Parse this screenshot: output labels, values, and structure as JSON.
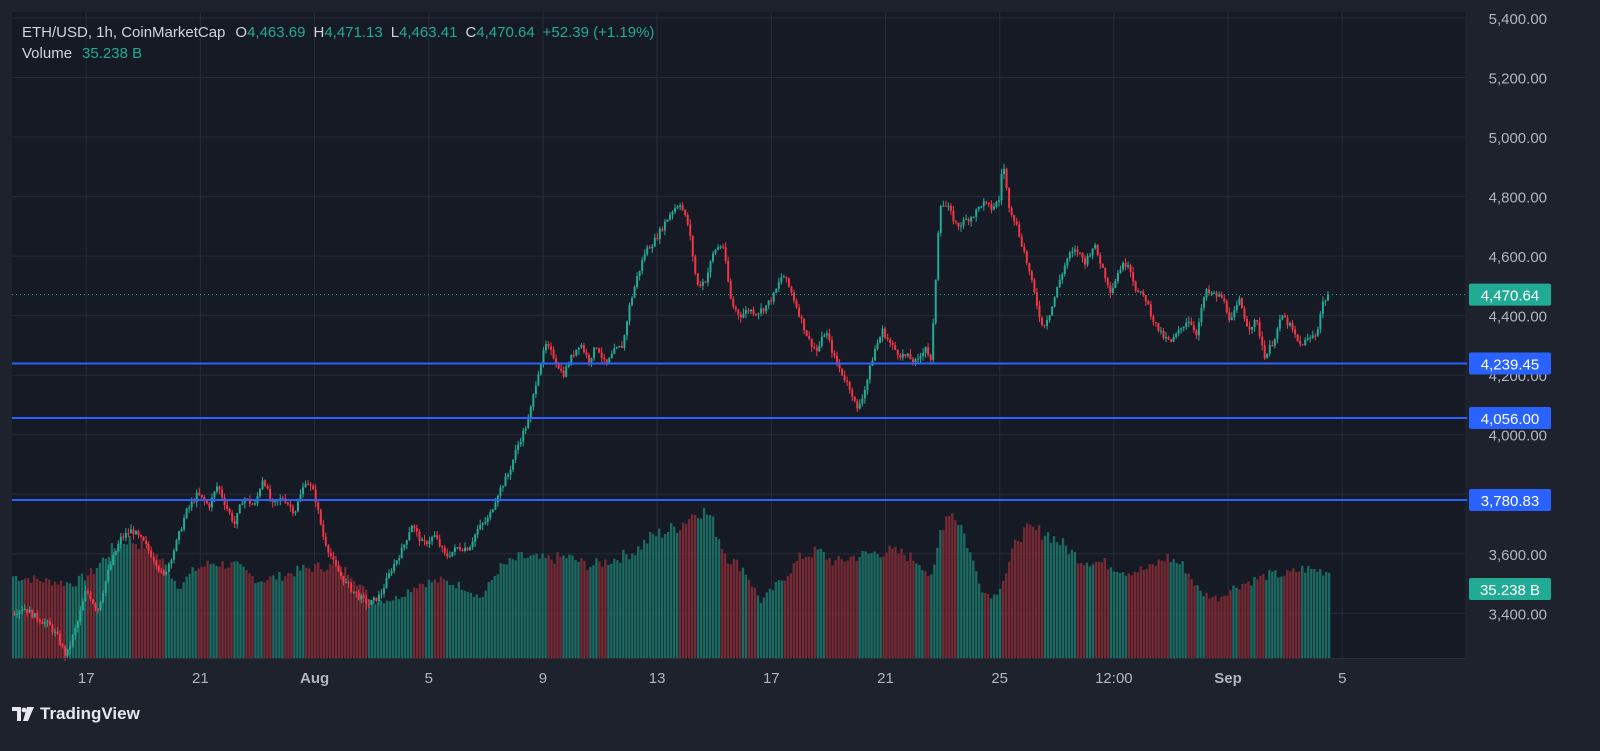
{
  "header": {
    "symbol": "ETH/USD, 1h, CoinMarketCap",
    "open_label": "O",
    "open": "4,463.69",
    "high_label": "H",
    "high": "4,471.13",
    "low_label": "L",
    "low": "4,463.41",
    "close_label": "C",
    "close": "4,470.64",
    "change": "+52.39 (+1.19%)",
    "volume_label": "Volume",
    "volume": "35.238 B"
  },
  "branding": {
    "logo_text": "TradingView"
  },
  "colors": {
    "background": "#1e222d",
    "plot_background": "#161a25",
    "grid": "#262b38",
    "up": "#22ab94",
    "down": "#f23645",
    "level_line": "#2962ff",
    "level_badge": "#2962ff",
    "price_badge": "#22ab94",
    "volume_up": "#1b6e63",
    "volume_down": "#7a2a33"
  },
  "chart_data": {
    "type": "candlestick",
    "symbol": "ETH/USD",
    "interval": "1h",
    "source": "CoinMarketCap",
    "ylim": [
      3250,
      5420
    ],
    "y_ticks": [
      3400,
      3600,
      3800,
      4000,
      4200,
      4400,
      4600,
      4800,
      5000,
      5200,
      5400
    ],
    "y_tick_labels": [
      "3,400.00",
      "3,600.00",
      "3,800.00",
      "4,000.00",
      "4,200.00",
      "4,400.00",
      "4,600.00",
      "4,800.00",
      "5,000.00",
      "5,200.00",
      "5,400.00"
    ],
    "x_ticks": [
      {
        "x": 1,
        "label": "17"
      },
      {
        "x": 5,
        "label": "21"
      },
      {
        "x": 9,
        "label": "Aug"
      },
      {
        "x": 13,
        "label": "5"
      },
      {
        "x": 17,
        "label": "9"
      },
      {
        "x": 21,
        "label": "13"
      },
      {
        "x": 25,
        "label": "17"
      },
      {
        "x": 29,
        "label": "21"
      },
      {
        "x": 33,
        "label": "25"
      },
      {
        "x": 37,
        "label": "12:00"
      },
      {
        "x": 41,
        "label": "Sep"
      },
      {
        "x": 45,
        "label": "5"
      }
    ],
    "x_range": [
      -1.6,
      49.3
    ],
    "price_path": [
      [
        -1.6,
        3400
      ],
      [
        -1.2,
        3420
      ],
      [
        -0.8,
        3390
      ],
      [
        -0.3,
        3360
      ],
      [
        0.0,
        3320
      ],
      [
        0.3,
        3255
      ],
      [
        0.7,
        3370
      ],
      [
        1.0,
        3480
      ],
      [
        1.4,
        3410
      ],
      [
        1.8,
        3550
      ],
      [
        2.2,
        3650
      ],
      [
        2.6,
        3680
      ],
      [
        3.0,
        3640
      ],
      [
        3.4,
        3580
      ],
      [
        3.7,
        3520
      ],
      [
        4.1,
        3620
      ],
      [
        4.5,
        3740
      ],
      [
        4.9,
        3800
      ],
      [
        5.3,
        3760
      ],
      [
        5.6,
        3830
      ],
      [
        5.9,
        3760
      ],
      [
        6.2,
        3700
      ],
      [
        6.5,
        3790
      ],
      [
        6.9,
        3760
      ],
      [
        7.2,
        3860
      ],
      [
        7.5,
        3760
      ],
      [
        7.9,
        3790
      ],
      [
        8.3,
        3740
      ],
      [
        8.7,
        3850
      ],
      [
        9.0,
        3800
      ],
      [
        9.3,
        3660
      ],
      [
        9.7,
        3560
      ],
      [
        10.1,
        3500
      ],
      [
        10.5,
        3460
      ],
      [
        10.9,
        3430
      ],
      [
        11.3,
        3460
      ],
      [
        11.7,
        3550
      ],
      [
        12.1,
        3620
      ],
      [
        12.4,
        3700
      ],
      [
        12.8,
        3630
      ],
      [
        13.2,
        3660
      ],
      [
        13.6,
        3590
      ],
      [
        14.0,
        3620
      ],
      [
        14.4,
        3620
      ],
      [
        14.7,
        3680
      ],
      [
        15.1,
        3720
      ],
      [
        15.4,
        3800
      ],
      [
        15.8,
        3870
      ],
      [
        16.1,
        3960
      ],
      [
        16.5,
        4050
      ],
      [
        16.8,
        4200
      ],
      [
        17.1,
        4300
      ],
      [
        17.4,
        4260
      ],
      [
        17.7,
        4200
      ],
      [
        18.0,
        4260
      ],
      [
        18.3,
        4310
      ],
      [
        18.6,
        4250
      ],
      [
        18.9,
        4300
      ],
      [
        19.2,
        4230
      ],
      [
        19.5,
        4280
      ],
      [
        19.8,
        4300
      ],
      [
        20.0,
        4420
      ],
      [
        20.3,
        4530
      ],
      [
        20.6,
        4620
      ],
      [
        20.9,
        4650
      ],
      [
        21.2,
        4700
      ],
      [
        21.5,
        4750
      ],
      [
        21.8,
        4780
      ],
      [
        22.1,
        4700
      ],
      [
        22.4,
        4500
      ],
      [
        22.7,
        4520
      ],
      [
        23.0,
        4620
      ],
      [
        23.3,
        4640
      ],
      [
        23.6,
        4440
      ],
      [
        23.9,
        4400
      ],
      [
        24.2,
        4420
      ],
      [
        24.5,
        4410
      ],
      [
        24.8,
        4430
      ],
      [
        25.1,
        4470
      ],
      [
        25.4,
        4540
      ],
      [
        25.7,
        4480
      ],
      [
        26.0,
        4400
      ],
      [
        26.3,
        4320
      ],
      [
        26.6,
        4280
      ],
      [
        26.9,
        4350
      ],
      [
        27.2,
        4260
      ],
      [
        27.5,
        4200
      ],
      [
        27.8,
        4150
      ],
      [
        28.0,
        4080
      ],
      [
        28.3,
        4160
      ],
      [
        28.6,
        4280
      ],
      [
        28.9,
        4350
      ],
      [
        29.2,
        4300
      ],
      [
        29.5,
        4270
      ],
      [
        29.8,
        4260
      ],
      [
        30.1,
        4240
      ],
      [
        30.4,
        4300
      ],
      [
        30.6,
        4240
      ],
      [
        30.8,
        4600
      ],
      [
        30.9,
        4780
      ],
      [
        31.2,
        4760
      ],
      [
        31.5,
        4700
      ],
      [
        31.8,
        4720
      ],
      [
        32.1,
        4740
      ],
      [
        32.4,
        4780
      ],
      [
        32.7,
        4760
      ],
      [
        33.0,
        4790
      ],
      [
        33.1,
        4930
      ],
      [
        33.3,
        4780
      ],
      [
        33.6,
        4700
      ],
      [
        33.9,
        4600
      ],
      [
        34.2,
        4480
      ],
      [
        34.5,
        4360
      ],
      [
        34.8,
        4420
      ],
      [
        35.1,
        4520
      ],
      [
        35.4,
        4600
      ],
      [
        35.7,
        4620
      ],
      [
        36.0,
        4580
      ],
      [
        36.3,
        4640
      ],
      [
        36.6,
        4560
      ],
      [
        36.9,
        4480
      ],
      [
        37.2,
        4560
      ],
      [
        37.5,
        4580
      ],
      [
        37.8,
        4480
      ],
      [
        38.1,
        4460
      ],
      [
        38.4,
        4380
      ],
      [
        38.7,
        4330
      ],
      [
        39.0,
        4310
      ],
      [
        39.3,
        4350
      ],
      [
        39.6,
        4390
      ],
      [
        39.9,
        4340
      ],
      [
        40.2,
        4480
      ],
      [
        40.5,
        4470
      ],
      [
        40.8,
        4460
      ],
      [
        41.1,
        4380
      ],
      [
        41.4,
        4450
      ],
      [
        41.7,
        4360
      ],
      [
        42.0,
        4380
      ],
      [
        42.3,
        4260
      ],
      [
        42.6,
        4320
      ],
      [
        42.9,
        4400
      ],
      [
        43.2,
        4360
      ],
      [
        43.5,
        4300
      ],
      [
        43.8,
        4320
      ],
      [
        44.1,
        4340
      ],
      [
        44.3,
        4440
      ],
      [
        44.5,
        4470.64
      ]
    ],
    "volume_profile_note": "Volume histogram overlaid at the bottom of the plot",
    "volume_path": [
      [
        -1.6,
        0.55
      ],
      [
        -0.5,
        0.52
      ],
      [
        0.5,
        0.5
      ],
      [
        1.2,
        0.58
      ],
      [
        1.8,
        0.72
      ],
      [
        2.4,
        0.8
      ],
      [
        3.0,
        0.76
      ],
      [
        3.6,
        0.66
      ],
      [
        4.2,
        0.48
      ],
      [
        4.8,
        0.6
      ],
      [
        5.4,
        0.64
      ],
      [
        6.2,
        0.62
      ],
      [
        7.0,
        0.52
      ],
      [
        7.8,
        0.55
      ],
      [
        8.6,
        0.6
      ],
      [
        9.4,
        0.62
      ],
      [
        10.2,
        0.58
      ],
      [
        11.0,
        0.38
      ],
      [
        11.8,
        0.4
      ],
      [
        12.6,
        0.5
      ],
      [
        13.4,
        0.52
      ],
      [
        14.2,
        0.48
      ],
      [
        14.8,
        0.4
      ],
      [
        15.4,
        0.6
      ],
      [
        16.2,
        0.68
      ],
      [
        17.0,
        0.66
      ],
      [
        17.8,
        0.68
      ],
      [
        18.6,
        0.62
      ],
      [
        19.4,
        0.66
      ],
      [
        20.2,
        0.72
      ],
      [
        20.8,
        0.82
      ],
      [
        21.4,
        0.86
      ],
      [
        21.8,
        0.9
      ],
      [
        22.4,
        1.0
      ],
      [
        22.8,
        0.96
      ],
      [
        23.4,
        0.68
      ],
      [
        24.0,
        0.6
      ],
      [
        24.6,
        0.38
      ],
      [
        25.4,
        0.54
      ],
      [
        26.0,
        0.68
      ],
      [
        26.6,
        0.72
      ],
      [
        27.2,
        0.64
      ],
      [
        27.8,
        0.68
      ],
      [
        28.4,
        0.7
      ],
      [
        29.0,
        0.72
      ],
      [
        29.6,
        0.7
      ],
      [
        30.2,
        0.64
      ],
      [
        30.6,
        0.52
      ],
      [
        30.9,
        0.88
      ],
      [
        31.2,
        1.0
      ],
      [
        31.6,
        0.9
      ],
      [
        32.0,
        0.66
      ],
      [
        32.4,
        0.44
      ],
      [
        32.8,
        0.42
      ],
      [
        33.2,
        0.58
      ],
      [
        33.6,
        0.82
      ],
      [
        34.0,
        0.86
      ],
      [
        34.6,
        0.84
      ],
      [
        35.2,
        0.76
      ],
      [
        35.8,
        0.66
      ],
      [
        36.6,
        0.64
      ],
      [
        37.4,
        0.58
      ],
      [
        38.2,
        0.6
      ],
      [
        38.8,
        0.68
      ],
      [
        39.4,
        0.62
      ],
      [
        40.0,
        0.44
      ],
      [
        40.6,
        0.4
      ],
      [
        41.2,
        0.48
      ],
      [
        41.8,
        0.52
      ],
      [
        42.4,
        0.56
      ],
      [
        43.0,
        0.56
      ],
      [
        43.6,
        0.6
      ],
      [
        44.5,
        0.58
      ]
    ],
    "levels": [
      4239.45,
      4056.0,
      3780.83
    ],
    "level_labels": [
      "4,239.45",
      "4,056.00",
      "3,780.83"
    ],
    "last_price": 4470.64,
    "last_price_label": "4,470.64",
    "last_volume_label": "35.238 B",
    "grid": true
  }
}
